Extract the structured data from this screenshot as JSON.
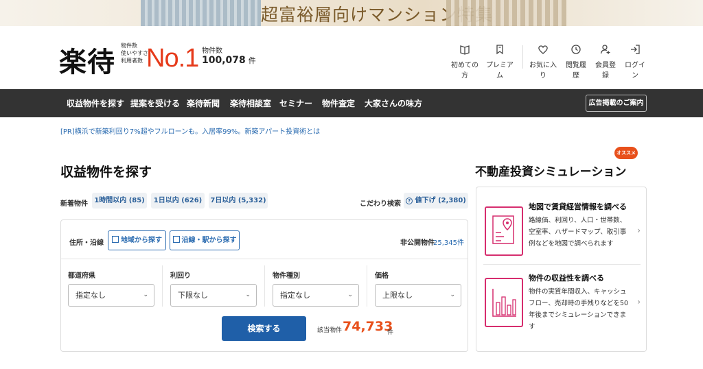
{
  "banner": {
    "text": "超富裕層向けマンション特集"
  },
  "header": {
    "logo": "楽待",
    "no1_labels": [
      "物件数",
      "使いやすさ",
      "利用者数"
    ],
    "no1": "No.1",
    "count_label": "物件数",
    "count_value": "100,078",
    "count_unit": "件",
    "nav": [
      {
        "label": "初めての方",
        "icon": "book-icon"
      },
      {
        "label": "プレミアム",
        "icon": "bookmark-icon"
      },
      {
        "label": "お気に入り",
        "icon": "heart-icon"
      },
      {
        "label": "閲覧履歴",
        "icon": "clock-icon"
      },
      {
        "label": "会員登録",
        "icon": "user-add-icon"
      },
      {
        "label": "ログイン",
        "icon": "login-icon"
      }
    ]
  },
  "navbar": {
    "items": [
      "収益物件を探す",
      "提案を受ける",
      "楽待新聞",
      "楽待相談室",
      "セミナー",
      "物件査定",
      "大家さんの味方"
    ],
    "ad": "広告掲載のご案内"
  },
  "pr": "[PR]横浜で新築利回り7%超やフルローンも。入居率99%。新築アパート投資術とは",
  "search": {
    "title": "収益物件を探す",
    "new_label": "新着物件",
    "chips": [
      "1時間以内 (85)",
      "1日以内 (626)",
      "7日以内 (5,332)"
    ],
    "kodawari_label": "こだわり検索",
    "price_down": "値下げ (2,380)",
    "addr_label": "住所・沿線",
    "addr_buttons": [
      "地域から探す",
      "沿線・駅から探す"
    ],
    "hikokai_label": "非公開物件",
    "hikokai_value": "25,345件",
    "filters": [
      {
        "label": "都道府県",
        "value": "指定なし"
      },
      {
        "label": "利回り",
        "value": "下限なし"
      },
      {
        "label": "物件種別",
        "value": "指定なし"
      },
      {
        "label": "価格",
        "value": "上限なし"
      }
    ],
    "search_button": "検索する",
    "hit_label": "該当物件",
    "hit_value": "74,733",
    "hit_unit": "件"
  },
  "simulation": {
    "title": "不動産投資シミュレーション",
    "badge": "オススメ",
    "items": [
      {
        "title": "地図で賃貸経営情報を調べる",
        "desc": "路線価、利回り、人口・世帯数、空室率、ハザードマップ、取引事例などを地図で調べられます"
      },
      {
        "title": "物件の収益性を調べる",
        "desc": "物件の実質年間収入、キャッシュフロー、売却時の手残りなどを50年後までシミュレーションできます"
      }
    ]
  },
  "colors": {
    "accent_blue": "#1f5fa8",
    "accent_orange": "#e8501b",
    "nav_bg": "#333333",
    "no1_red": "#e63a1a"
  }
}
